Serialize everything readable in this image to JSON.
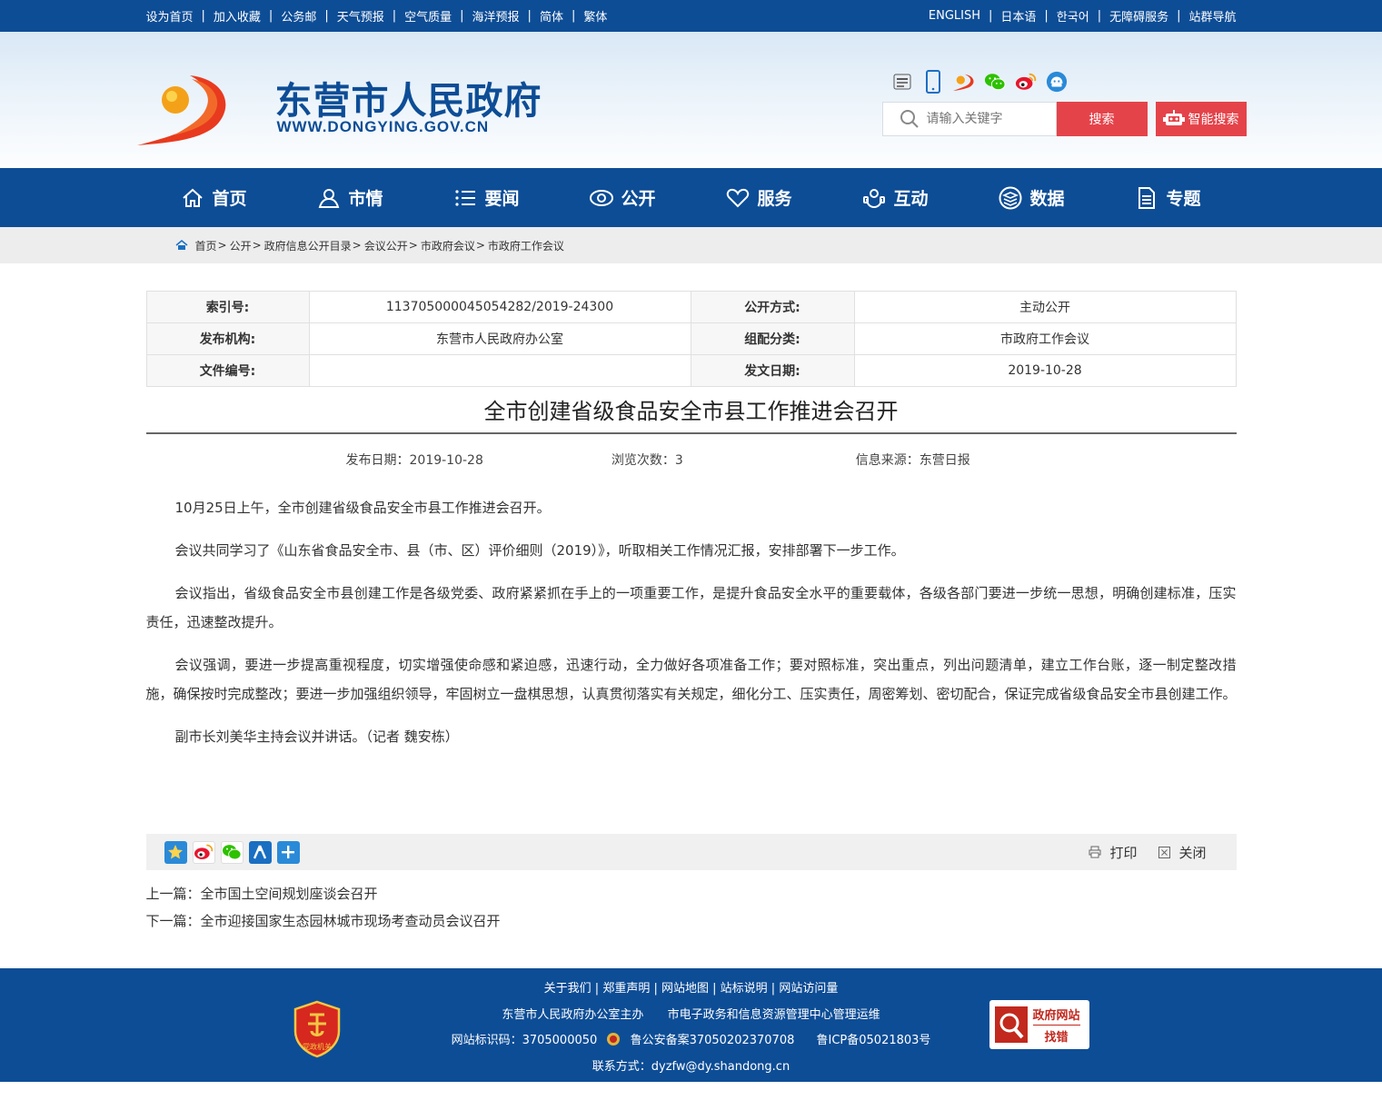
{
  "topbar": {
    "left": [
      "设为首页",
      "加入收藏",
      "公务邮",
      "天气预报",
      "空气质量",
      "海洋预报",
      "简体",
      "繁体"
    ],
    "right": [
      "ENGLISH",
      "日本语",
      "한국어",
      "无障碍服务",
      "站群导航"
    ]
  },
  "header": {
    "site_title": "东营市人民政府",
    "site_url": "WWW.DONGYING.GOV.CN",
    "search_placeholder": "请输入关键字",
    "search_button": "搜索",
    "smart_search_button": "智能搜索",
    "social_icons": [
      "service-hall-icon",
      "mobile-icon",
      "app-icon",
      "wechat-icon",
      "weibo-icon",
      "assistant-icon"
    ]
  },
  "nav": {
    "items": [
      {
        "label": "首页",
        "icon": "home-icon"
      },
      {
        "label": "市情",
        "icon": "city-icon"
      },
      {
        "label": "要闻",
        "icon": "list-icon"
      },
      {
        "label": "公开",
        "icon": "eye-icon"
      },
      {
        "label": "服务",
        "icon": "heart-icon"
      },
      {
        "label": "互动",
        "icon": "interaction-icon"
      },
      {
        "label": "数据",
        "icon": "data-icon"
      },
      {
        "label": "专题",
        "icon": "document-icon"
      }
    ]
  },
  "breadcrumb": [
    "首页",
    "公开",
    "政府信息公开目录",
    "会议公开",
    "市政府会议",
    "市政府工作会议"
  ],
  "meta": {
    "index_label": "索引号:",
    "index_value": "113705000045054282/2019-24300",
    "open_mode_label": "公开方式:",
    "open_mode_value": "主动公开",
    "publisher_label": "发布机构:",
    "publisher_value": "东营市人民政府办公室",
    "category_label": "组配分类:",
    "category_value": "市政府工作会议",
    "doc_no_label": "文件编号:",
    "doc_no_value": "",
    "date_label": "发文日期:",
    "date_value": "2019-10-28"
  },
  "article": {
    "title": "全市创建省级食品安全市县工作推进会召开",
    "publish_date": "发布日期：2019-10-28",
    "views": "浏览次数：3",
    "source": "信息来源：东营日报",
    "paragraphs": [
      "10月25日上午，全市创建省级食品安全市县工作推进会召开。",
      "会议共同学习了《山东省食品安全市、县（市、区）评价细则（2019）》，听取相关工作情况汇报，安排部署下一步工作。",
      "会议指出，省级食品安全市县创建工作是各级党委、政府紧紧抓在手上的一项重要工作，是提升食品安全水平的重要载体，各级各部门要进一步统一思想，明确创建标准，压实责任，迅速整改提升。",
      "会议强调，要进一步提高重视程度，切实增强使命感和紧迫感，迅速行动，全力做好各项准备工作；要对照标准，突出重点，列出问题清单，建立工作台账，逐一制定整改措施，确保按时完成整改；要进一步加强组织领导，牢固树立一盘棋思想，认真贯彻落实有关规定，细化分工、压实责任，周密筹划、密切配合，保证完成省级食品安全市县创建工作。",
      "副市长刘美华主持会议并讲话。（记者 魏安栋）"
    ]
  },
  "actions": {
    "print": "打印",
    "close": "关闭"
  },
  "share_icons": [
    "favorite-icon",
    "weibo-share-icon",
    "wechat-share-icon",
    "renren-icon",
    "more-share-icon"
  ],
  "prevnext": {
    "prev_label": "上一篇：",
    "prev_title": "全市国土空间规划座谈会召开",
    "next_label": "下一篇：",
    "next_title": "全市迎接国家生态园林城市现场考查动员会议召开"
  },
  "footer": {
    "links": [
      "关于我们",
      "郑重声明",
      "网站地图",
      "站标说明",
      "网站访问量"
    ],
    "host": "东营市人民政府办公室主办",
    "operator": "市电子政务和信息资源管理中心管理运维",
    "site_code": "网站标识码：3705000050",
    "police_record": "鲁公安备案37050202370708",
    "icp": "鲁ICP备05021803号",
    "contact": "联系方式：dyzfw@dy.shandong.cn",
    "badge_text": "党政机关",
    "jiucuo_line1": "政府网站",
    "jiucuo_line2": "找错"
  },
  "colors": {
    "primary": "#0d4d96",
    "accent": "#e5434a"
  }
}
